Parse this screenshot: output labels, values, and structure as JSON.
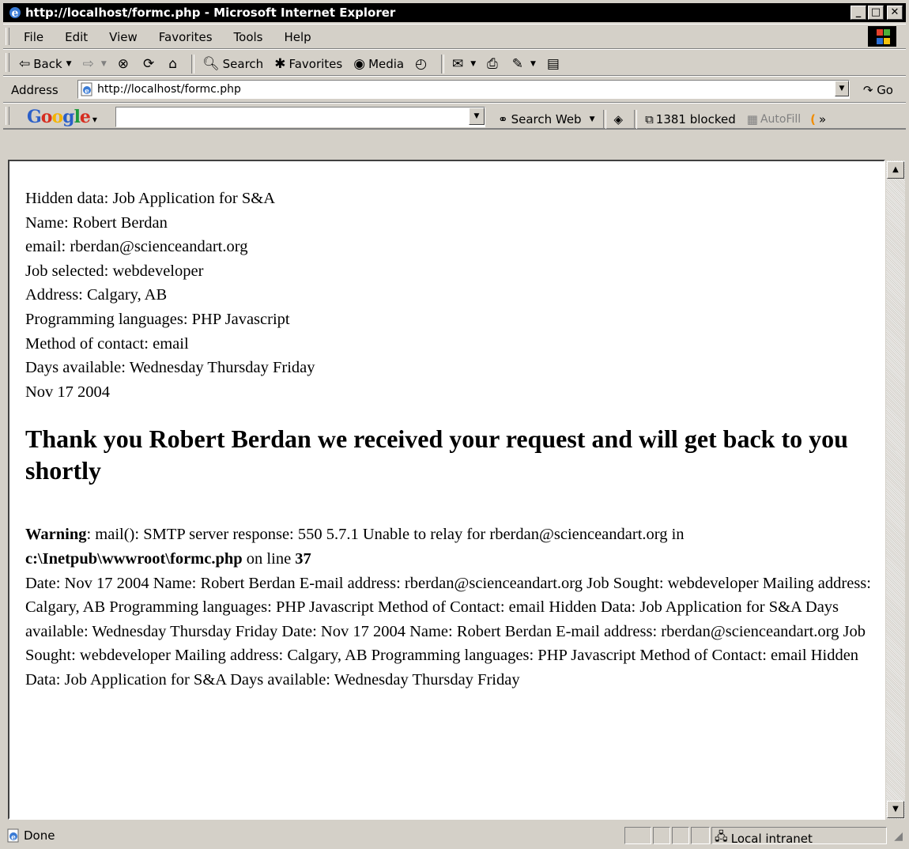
{
  "window": {
    "title": "http://localhost/formc.php - Microsoft Internet Explorer"
  },
  "menu": {
    "items": [
      "File",
      "Edit",
      "View",
      "Favorites",
      "Tools",
      "Help"
    ]
  },
  "toolbar": {
    "back": "Back",
    "search": "Search",
    "favorites": "Favorites",
    "media": "Media"
  },
  "address": {
    "label": "Address",
    "url": "http://localhost/formc.php",
    "go": "Go"
  },
  "google": {
    "logo": "Google",
    "search_web": "Search Web",
    "blocked": "1381 blocked",
    "autofill": "AutoFill",
    "more": "»"
  },
  "page": {
    "lines": [
      "Hidden data: Job Application for S&A",
      "Name: Robert Berdan",
      "email: rberdan@scienceandart.org",
      "Job selected: webdeveloper",
      "Address: Calgary, AB",
      "Programming languages: PHP Javascript",
      "Method of contact: email",
      "Days available: Wednesday Thursday Friday",
      "Nov 17 2004"
    ],
    "heading": "Thank you Robert Berdan we received your request and will get back to you shortly",
    "warning_label": "Warning",
    "warning_text": ": mail(): SMTP server response: 550 5.7.1 Unable to relay for rberdan@scienceandart.org in ",
    "warning_file": "c:\\Inetpub\\wwwroot\\formc.php",
    "warning_online": " on line ",
    "warning_line": "37",
    "body_text": "Date: Nov 17 2004 Name: Robert Berdan E-mail address: rberdan@scienceandart.org Job Sought: webdeveloper Mailing address: Calgary, AB Programming languages: PHP Javascript Method of Contact: email Hidden Data: Job Application for S&A Days available: Wednesday Thursday Friday Date: Nov 17 2004 Name: Robert Berdan E-mail address: rberdan@scienceandart.org Job Sought: webdeveloper Mailing address: Calgary, AB Programming languages: PHP Javascript Method of Contact: email Hidden Data: Job Application for S&A Days available: Wednesday Thursday Friday"
  },
  "status": {
    "text": "Done",
    "zone": "Local intranet"
  }
}
